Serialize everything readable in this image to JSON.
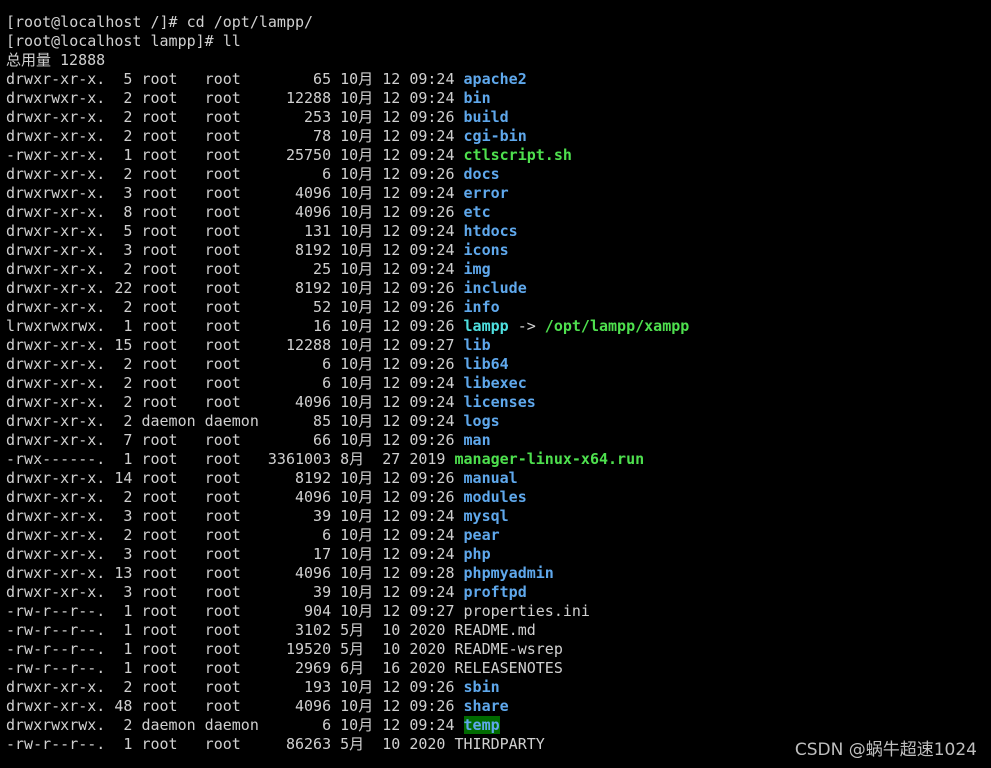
{
  "prompt_lines": [
    "[root@localhost /]# cd /opt/lampp/",
    "[root@localhost lampp]# ll",
    "总用量 12888"
  ],
  "colors": {
    "background": "#000000",
    "text": "#d0d0d0",
    "directory": "#5fa8ec",
    "executable": "#4ee04e",
    "sticky_dir_bg": "#006a00"
  },
  "listing": [
    {
      "prefix": "drwxr-xr-x.  5 root   root        65 10月 12 09:24 ",
      "name": "apache2",
      "type": "dir"
    },
    {
      "prefix": "drwxrwxr-x.  2 root   root     12288 10月 12 09:24 ",
      "name": "bin",
      "type": "dir"
    },
    {
      "prefix": "drwxr-xr-x.  2 root   root       253 10月 12 09:26 ",
      "name": "build",
      "type": "dir"
    },
    {
      "prefix": "drwxr-xr-x.  2 root   root        78 10月 12 09:24 ",
      "name": "cgi-bin",
      "type": "dir"
    },
    {
      "prefix": "-rwxr-xr-x.  1 root   root     25750 10月 12 09:24 ",
      "name": "ctlscript.sh",
      "type": "exe"
    },
    {
      "prefix": "drwxr-xr-x.  2 root   root         6 10月 12 09:26 ",
      "name": "docs",
      "type": "dir"
    },
    {
      "prefix": "drwxrwxr-x.  3 root   root      4096 10月 12 09:24 ",
      "name": "error",
      "type": "dir"
    },
    {
      "prefix": "drwxr-xr-x.  8 root   root      4096 10月 12 09:26 ",
      "name": "etc",
      "type": "dir"
    },
    {
      "prefix": "drwxr-xr-x.  5 root   root       131 10月 12 09:24 ",
      "name": "htdocs",
      "type": "dir"
    },
    {
      "prefix": "drwxr-xr-x.  3 root   root      8192 10月 12 09:24 ",
      "name": "icons",
      "type": "dir"
    },
    {
      "prefix": "drwxr-xr-x.  2 root   root        25 10月 12 09:24 ",
      "name": "img",
      "type": "dir"
    },
    {
      "prefix": "drwxr-xr-x. 22 root   root      8192 10月 12 09:26 ",
      "name": "include",
      "type": "dir"
    },
    {
      "prefix": "drwxr-xr-x.  2 root   root        52 10月 12 09:26 ",
      "name": "info",
      "type": "dir"
    },
    {
      "prefix": "lrwxrwxrwx.  1 root   root        16 10月 12 09:26 ",
      "name": "lampp",
      "type": "link",
      "arrow": " -> ",
      "target": "/opt/lampp/xampp"
    },
    {
      "prefix": "drwxr-xr-x. 15 root   root     12288 10月 12 09:27 ",
      "name": "lib",
      "type": "dir"
    },
    {
      "prefix": "drwxr-xr-x.  2 root   root         6 10月 12 09:26 ",
      "name": "lib64",
      "type": "dir"
    },
    {
      "prefix": "drwxr-xr-x.  2 root   root         6 10月 12 09:24 ",
      "name": "libexec",
      "type": "dir"
    },
    {
      "prefix": "drwxr-xr-x.  2 root   root      4096 10月 12 09:24 ",
      "name": "licenses",
      "type": "dir"
    },
    {
      "prefix": "drwxr-xr-x.  2 daemon daemon      85 10月 12 09:24 ",
      "name": "logs",
      "type": "dir"
    },
    {
      "prefix": "drwxr-xr-x.  7 root   root        66 10月 12 09:26 ",
      "name": "man",
      "type": "dir"
    },
    {
      "prefix": "-rwx------.  1 root   root   3361003 8月  27 2019 ",
      "name": "manager-linux-x64.run",
      "type": "exe"
    },
    {
      "prefix": "drwxr-xr-x. 14 root   root      8192 10月 12 09:26 ",
      "name": "manual",
      "type": "dir"
    },
    {
      "prefix": "drwxr-xr-x.  2 root   root      4096 10月 12 09:26 ",
      "name": "modules",
      "type": "dir"
    },
    {
      "prefix": "drwxr-xr-x.  3 root   root        39 10月 12 09:24 ",
      "name": "mysql",
      "type": "dir"
    },
    {
      "prefix": "drwxr-xr-x.  2 root   root         6 10月 12 09:24 ",
      "name": "pear",
      "type": "dir"
    },
    {
      "prefix": "drwxr-xr-x.  3 root   root        17 10月 12 09:24 ",
      "name": "php",
      "type": "dir"
    },
    {
      "prefix": "drwxr-xr-x. 13 root   root      4096 10月 12 09:28 ",
      "name": "phpmyadmin",
      "type": "dir"
    },
    {
      "prefix": "drwxr-xr-x.  3 root   root        39 10月 12 09:24 ",
      "name": "proftpd",
      "type": "dir"
    },
    {
      "prefix": "-rw-r--r--.  1 root   root       904 10月 12 09:27 ",
      "name": "properties.ini",
      "type": "file"
    },
    {
      "prefix": "-rw-r--r--.  1 root   root      3102 5月  10 2020 ",
      "name": "README.md",
      "type": "file"
    },
    {
      "prefix": "-rw-r--r--.  1 root   root     19520 5月  10 2020 ",
      "name": "README-wsrep",
      "type": "file"
    },
    {
      "prefix": "-rw-r--r--.  1 root   root      2969 6月  16 2020 ",
      "name": "RELEASENOTES",
      "type": "file"
    },
    {
      "prefix": "drwxr-xr-x.  2 root   root       193 10月 12 09:26 ",
      "name": "sbin",
      "type": "dir"
    },
    {
      "prefix": "drwxr-xr-x. 48 root   root      4096 10月 12 09:26 ",
      "name": "share",
      "type": "dir"
    },
    {
      "prefix": "drwxrwxrwx.  2 daemon daemon       6 10月 12 09:24 ",
      "name": "temp",
      "type": "sticky"
    },
    {
      "prefix": "-rw-r--r--.  1 root   root     86263 5月  10 2020 ",
      "name": "THIRDPARTY",
      "type": "file"
    }
  ],
  "watermark": "CSDN @蜗牛超速1024"
}
